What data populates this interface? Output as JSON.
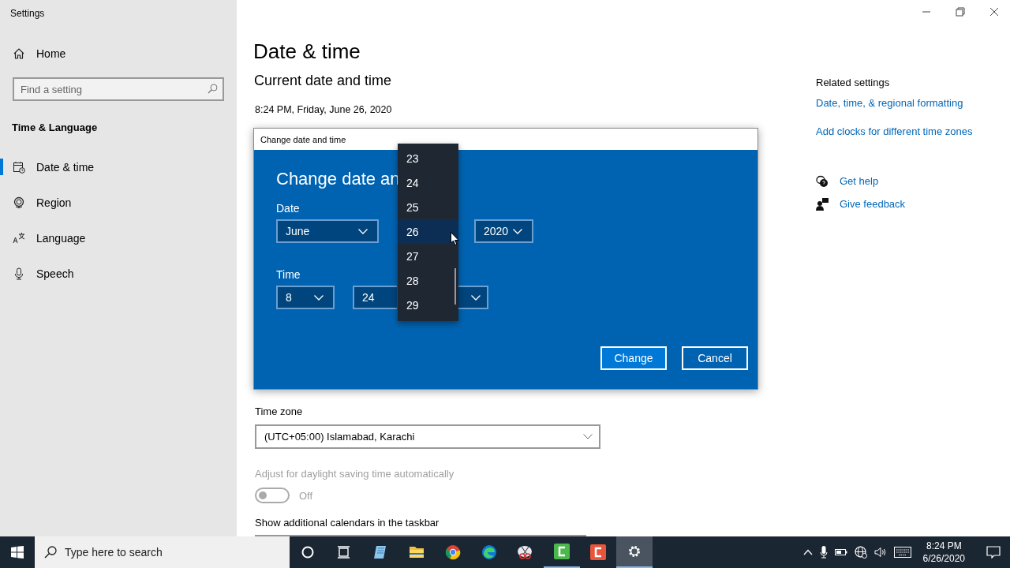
{
  "window": {
    "title": "Settings"
  },
  "sidebar": {
    "home": "Home",
    "search": {
      "placeholder": "Find a setting"
    },
    "section": "Time & Language",
    "items": [
      {
        "label": "Date & time",
        "kind": "calendar",
        "selected": true
      },
      {
        "label": "Region",
        "kind": "globe",
        "selected": false
      },
      {
        "label": "Language",
        "kind": "language",
        "selected": false
      },
      {
        "label": "Speech",
        "kind": "microphone",
        "selected": false
      }
    ]
  },
  "page": {
    "title": "Date & time",
    "subtitle": "Current date and time",
    "current": "8:24 PM, Friday, June 26, 2020",
    "time_zone": {
      "label": "Time zone",
      "value": "(UTC+05:00) Islamabad, Karachi"
    },
    "daylight": {
      "label": "Adjust for daylight saving time automatically",
      "disabled": true,
      "on": false,
      "state_text": "Off"
    },
    "calendars": {
      "label": "Show additional calendars in the taskbar"
    }
  },
  "related": {
    "title": "Related settings",
    "links": [
      "Date, time, & regional formatting",
      "Add clocks for different time zones"
    ],
    "support": [
      {
        "kind": "help",
        "label": "Get help"
      },
      {
        "kind": "feedback",
        "label": "Give feedback"
      }
    ]
  },
  "dialog": {
    "title": "Change date and time",
    "heading": "Change date an",
    "date_label": "Date",
    "month": "June",
    "year": "2020",
    "time_label": "Time",
    "hour": "8",
    "minute": "24",
    "buttons": [
      {
        "label": "Change",
        "kind": "primary"
      },
      {
        "label": "Cancel",
        "kind": "secondary"
      }
    ]
  },
  "day_list": [
    {
      "label": "23",
      "selected": false
    },
    {
      "label": "24",
      "selected": false
    },
    {
      "label": "25",
      "selected": false
    },
    {
      "label": "26",
      "selected": true
    },
    {
      "label": "27",
      "selected": false
    },
    {
      "label": "28",
      "selected": false
    },
    {
      "label": "29",
      "selected": false
    }
  ],
  "taskbar": {
    "search": {
      "placeholder": "Type here to search"
    },
    "apps": [
      {
        "kind": "cortana",
        "selected": false,
        "running": false
      },
      {
        "kind": "taskview",
        "selected": false,
        "running": false
      },
      {
        "kind": "notepad",
        "selected": false,
        "running": false
      },
      {
        "kind": "folder",
        "selected": false,
        "running": false
      },
      {
        "kind": "chrome",
        "selected": false,
        "running": false
      },
      {
        "kind": "edge",
        "selected": false,
        "running": false
      },
      {
        "kind": "snip",
        "selected": false,
        "running": false
      },
      {
        "kind": "recorder",
        "selected": false,
        "running": true
      },
      {
        "kind": "editor",
        "selected": false,
        "running": false
      },
      {
        "kind": "settings",
        "selected": true,
        "running": true
      }
    ],
    "clock": {
      "time": "8:24 PM",
      "date": "6/26/2020"
    }
  }
}
